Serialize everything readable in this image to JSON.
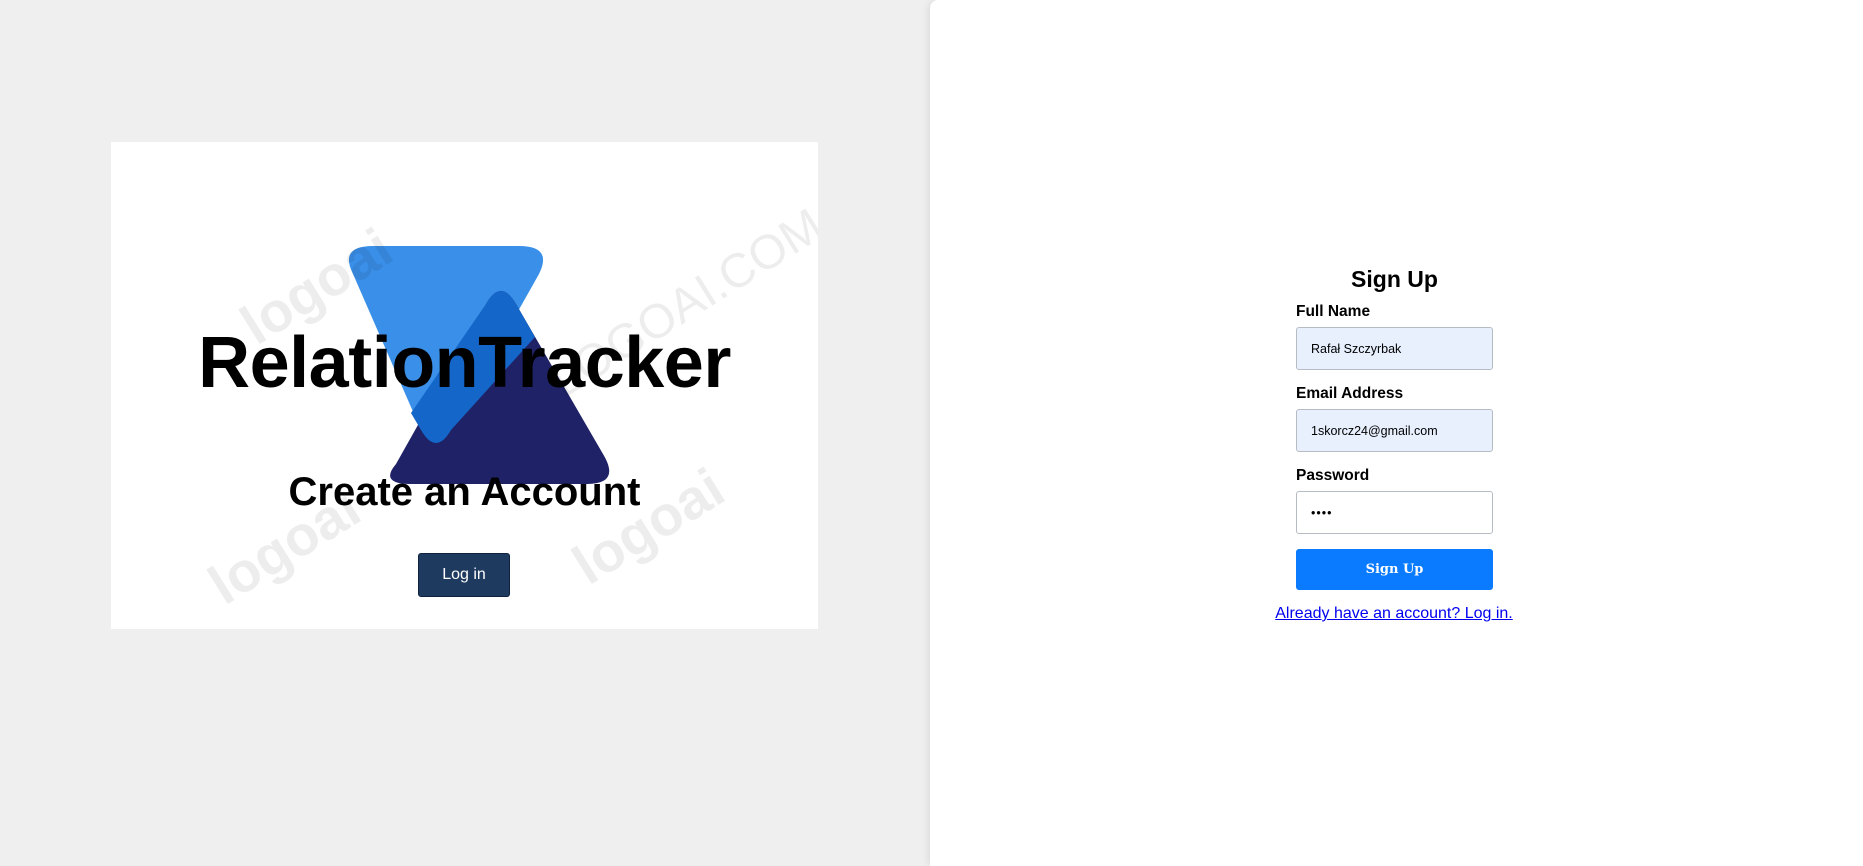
{
  "hero": {
    "brand_title": "RelationTracker",
    "heading": "Create an Account",
    "login_button": "Log in",
    "watermarks": [
      "logoai",
      "LOGOAI.COM",
      "logoai",
      "logoai"
    ]
  },
  "signup_form": {
    "title": "Sign Up",
    "full_name": {
      "label": "Full Name",
      "value": "Rafał Szczyrbak"
    },
    "email": {
      "label": "Email Address",
      "value": "1skorcz24@gmail.com"
    },
    "password": {
      "label": "Password",
      "value": "••••"
    },
    "submit_button": "Sign Up",
    "login_link": "Already have an account? Log in."
  },
  "colors": {
    "page_background": "#efefef",
    "logo_light_blue": "#3a8fe8",
    "logo_mid_blue": "#1466c9",
    "logo_navy": "#1f2266",
    "login_button_bg": "#1f3a5f",
    "submit_button_bg": "#0a7bff",
    "autofill_bg": "#e8f0fe",
    "link": "#0000ee"
  }
}
